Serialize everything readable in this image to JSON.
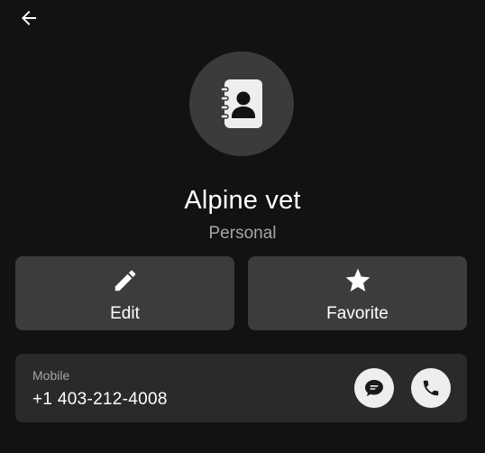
{
  "header": {
    "back_icon": "arrow-left-icon"
  },
  "contact": {
    "avatar_icon": "contact-book-icon",
    "name": "Alpine vet",
    "group": "Personal"
  },
  "actions": {
    "edit": {
      "label": "Edit",
      "icon": "pencil-icon"
    },
    "favorite": {
      "label": "Favorite",
      "icon": "star-icon"
    }
  },
  "phone": {
    "type": "Mobile",
    "number": "+1 403-212-4008",
    "message_icon": "message-icon",
    "call_icon": "phone-icon"
  },
  "colors": {
    "background": "#121212",
    "avatar_bg": "#3b3b3b",
    "button_bg": "#3c3c3c",
    "card_bg": "#2a2a2a",
    "round_button_bg": "#eeeeee",
    "secondary_text": "#a6a6a6"
  }
}
